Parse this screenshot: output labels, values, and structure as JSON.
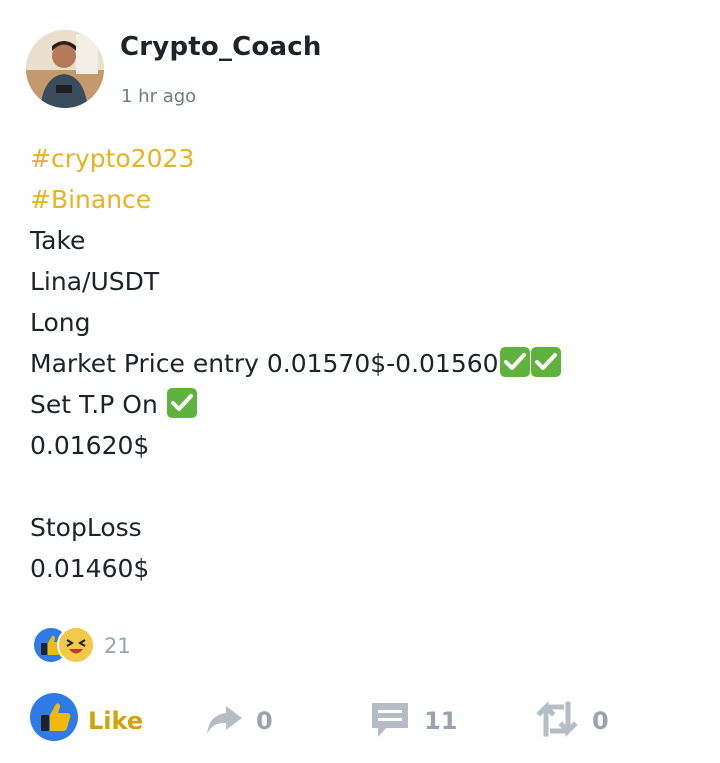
{
  "post": {
    "author": "Crypto_Coach",
    "time": "1 hr ago",
    "hashtags": [
      "#crypto2023",
      "#Binance"
    ],
    "lines": [
      "Take",
      "Lina/USDT",
      "Long",
      "Market Price entry 0.01570$-0.01560",
      "Set T.P On ",
      "0.01620$",
      "",
      "StopLoss",
      "0.01460$"
    ]
  },
  "reactions": {
    "icons": [
      "thumbs-up-icon",
      "laughing-face-icon"
    ],
    "count": "21"
  },
  "actions": {
    "like_label": "Like",
    "share_count": "0",
    "comment_count": "11",
    "repost_count": "0"
  },
  "colors": {
    "hashtag": "#E6B422",
    "like_blue": "#2F7BE5",
    "like_gold": "#F0B90B",
    "check_green": "#5FB33C",
    "muted": "#9AA3AF"
  }
}
